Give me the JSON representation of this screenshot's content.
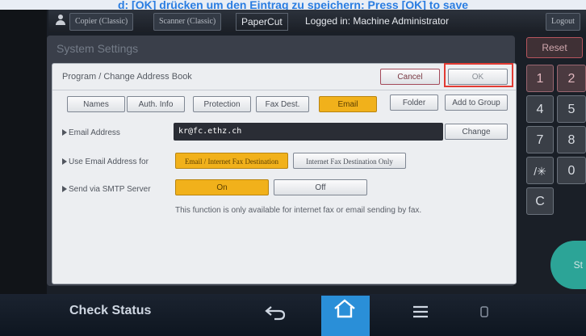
{
  "caption": "d: [OK] drücken um den Eintrag zu speichern: Press [OK] to save",
  "topbar": {
    "copier": "Copier (Classic)",
    "scanner": "Scanner (Classic)",
    "papercut": "PaperCut",
    "login": "Logged in: Machine Administrator",
    "logout": "Logout"
  },
  "screen": {
    "title": "System Settings"
  },
  "panel": {
    "header_title": "Program / Change Address Book",
    "cancel": "Cancel",
    "ok": "OK",
    "tabs": [
      "Names",
      "Auth. Info",
      "Protection",
      "Fax Dest.",
      "Email",
      "Folder",
      "Add to Group"
    ],
    "selected_tab": "Email",
    "rows": {
      "email_address_label": "Email Address",
      "email_value": "kr@fc.ethz.ch",
      "change": "Change",
      "use_for_label": "Use Email Address for",
      "use_for_option1": "Email / Internet Fax Destination",
      "use_for_option2": "Internet Fax Destination Only",
      "smtp_label": "Send via SMTP Server",
      "smtp_on": "On",
      "smtp_off": "Off",
      "note": "This function is only available for internet fax or email sending by fax."
    }
  },
  "keypad": {
    "reset": "Reset",
    "keys": [
      "1",
      "2",
      "4",
      "5",
      "7",
      "8",
      "/✳",
      "0",
      "C"
    ],
    "start": "St"
  },
  "bottombar": {
    "check_status": "Check Status"
  },
  "colors": {
    "selected": "#f1b11b",
    "highlight": "#e23b33",
    "home": "#2a8fd8"
  }
}
